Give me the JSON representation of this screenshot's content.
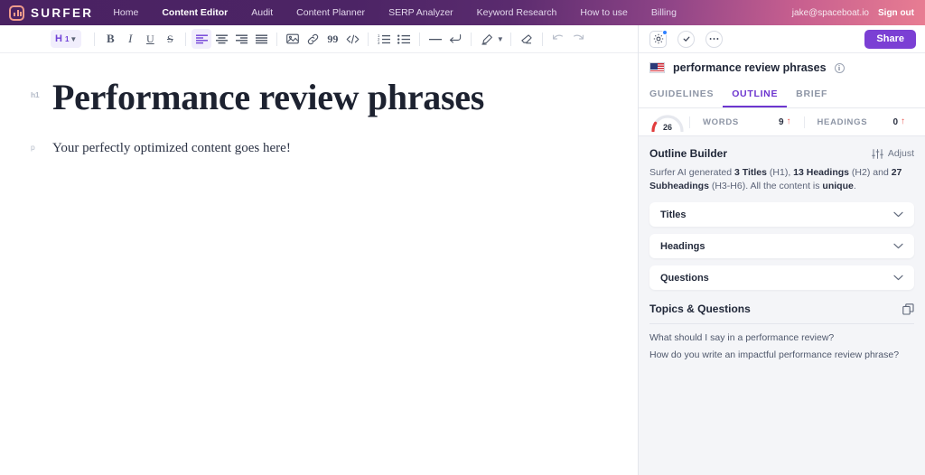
{
  "nav": {
    "brand": "SURFER",
    "logo_icon": "surfer-bars-logo",
    "links": [
      {
        "label": "Home",
        "active": false
      },
      {
        "label": "Content Editor",
        "active": true
      },
      {
        "label": "Audit",
        "active": false
      },
      {
        "label": "Content Planner",
        "active": false
      },
      {
        "label": "SERP Analyzer",
        "active": false
      },
      {
        "label": "Keyword Research",
        "active": false
      },
      {
        "label": "How to use",
        "active": false
      },
      {
        "label": "Billing",
        "active": false
      }
    ],
    "email": "jake@spaceboat.io",
    "signout": "Sign out"
  },
  "toolbar": {
    "style_label": "H",
    "style_sub": "1",
    "items": [
      {
        "name": "bold-icon",
        "glyph": "B"
      },
      {
        "name": "italic-icon",
        "glyph": "I"
      },
      {
        "name": "underline-icon",
        "glyph": "U"
      },
      {
        "name": "strikethrough-icon",
        "glyph": "S"
      },
      {
        "name": "align-left-icon",
        "glyph": ""
      },
      {
        "name": "align-center-icon",
        "glyph": ""
      },
      {
        "name": "align-right-icon",
        "glyph": ""
      },
      {
        "name": "align-justify-icon",
        "glyph": ""
      },
      {
        "name": "image-icon",
        "glyph": ""
      },
      {
        "name": "link-icon",
        "glyph": ""
      },
      {
        "name": "blockquote-icon",
        "glyph": "99"
      },
      {
        "name": "code-icon",
        "glyph": "</>"
      },
      {
        "name": "ordered-list-icon",
        "glyph": ""
      },
      {
        "name": "bullet-list-icon",
        "glyph": ""
      },
      {
        "name": "horizontal-rule-icon",
        "glyph": "—"
      },
      {
        "name": "line-break-icon",
        "glyph": ""
      },
      {
        "name": "highlighter-icon",
        "glyph": ""
      },
      {
        "name": "clear-format-icon",
        "glyph": ""
      },
      {
        "name": "undo-icon",
        "glyph": ""
      },
      {
        "name": "redo-icon",
        "glyph": ""
      }
    ]
  },
  "document": {
    "h1_gutter": "h1",
    "h1": "Performance review phrases",
    "p_gutter": "p",
    "p": "Your perfectly optimized content goes here!"
  },
  "panel": {
    "top": {
      "settings_icon": "gear-icon",
      "check_icon": "check-circle-icon",
      "more_icon": "more-circle-icon",
      "share_label": "Share"
    },
    "keyword": {
      "flag": "us-flag-icon",
      "title": "performance review phrases",
      "info_glyph": "i"
    },
    "tabs": [
      {
        "label": "Guidelines",
        "active": false
      },
      {
        "label": "Outline",
        "active": true
      },
      {
        "label": "Brief",
        "active": false
      }
    ],
    "stats": {
      "score": "26",
      "score_percent": 26,
      "score_color": "#e23c3c",
      "items": [
        {
          "label": "Words",
          "value": "9",
          "arrow": "↑"
        },
        {
          "label": "Headings",
          "value": "0",
          "arrow": "↑"
        }
      ]
    },
    "outline_builder": {
      "title": "Outline Builder",
      "adjust_label": "Adjust",
      "adjust_icon": "sliders-icon",
      "desc_1": "Surfer AI generated ",
      "desc_b1": "3 Titles",
      "desc_2": " (H1), ",
      "desc_b2": "13 Headings",
      "desc_3": " (H2) and ",
      "desc_b3": "27 Subheadings",
      "desc_4": " (H3-H6). All the content is ",
      "desc_b4": "unique",
      "desc_5": "."
    },
    "accordions": [
      {
        "label": "Titles",
        "icon": "chevron-down-icon"
      },
      {
        "label": "Headings",
        "icon": "chevron-down-icon"
      },
      {
        "label": "Questions",
        "icon": "chevron-down-icon"
      }
    ],
    "topics": {
      "title": "Topics & Questions",
      "copy_icon": "copy-icon",
      "items": [
        "What should I say in a performance review?",
        "How do you write an impactful performance review phrase?"
      ]
    }
  },
  "colors": {
    "accent_purple": "#6d36cf",
    "share_purple": "#7b3fd4",
    "nav_purple": "#4a2262",
    "nav_pink": "#e87d92",
    "alert_red": "#e8554e"
  }
}
